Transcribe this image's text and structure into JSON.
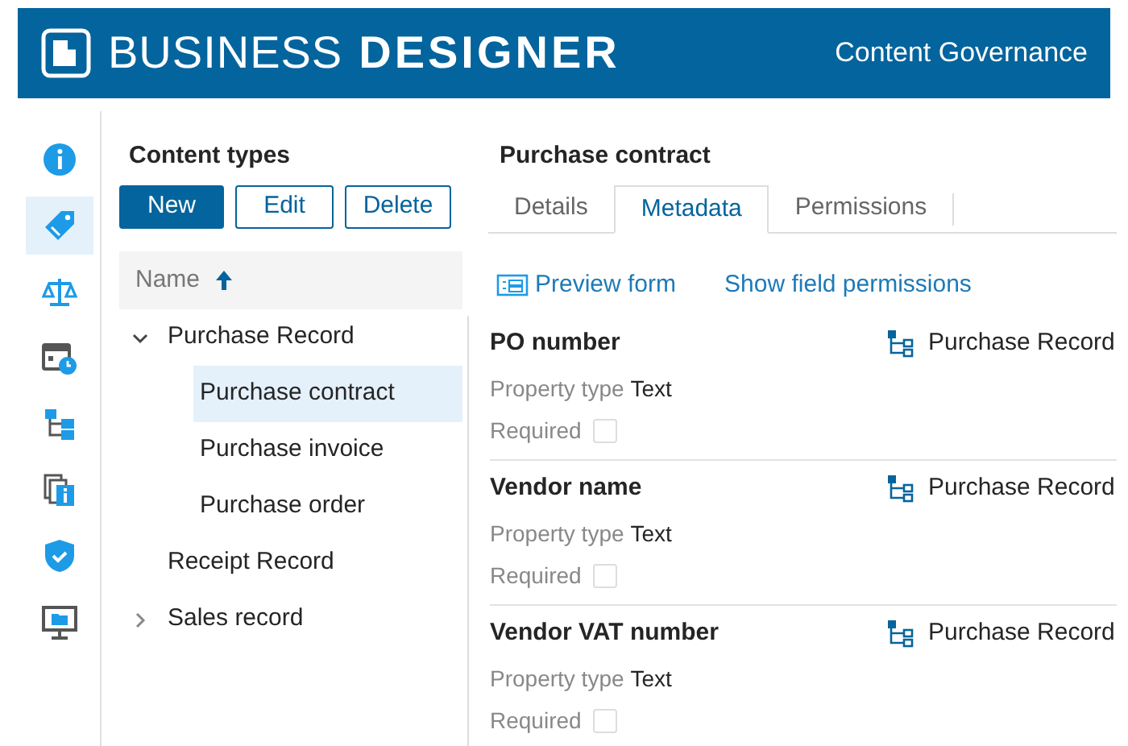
{
  "header": {
    "logo_light": "BUSINESS",
    "logo_bold": "DESIGNER",
    "title": "Content Governance"
  },
  "nav": [
    {
      "kind": "info",
      "selected": false
    },
    {
      "kind": "tag",
      "selected": true
    },
    {
      "kind": "scale",
      "selected": false
    },
    {
      "kind": "calendar",
      "selected": false
    },
    {
      "kind": "tree",
      "selected": false
    },
    {
      "kind": "docs",
      "selected": false
    },
    {
      "kind": "shield",
      "selected": false
    },
    {
      "kind": "monitor",
      "selected": false
    }
  ],
  "content_types": {
    "title": "Content types",
    "buttons": [
      {
        "label": "New",
        "primary": true
      },
      {
        "label": "Edit",
        "primary": false
      },
      {
        "label": "Delete",
        "primary": false
      }
    ],
    "column": {
      "label": "Name",
      "sorted_ascending": true
    },
    "tree": [
      {
        "label": "Purchase Record",
        "expanded": true,
        "selected": false,
        "children": [
          {
            "label": "Purchase contract",
            "selected": true
          },
          {
            "label": "Purchase invoice",
            "selected": false
          },
          {
            "label": "Purchase order",
            "selected": false
          }
        ]
      },
      {
        "label": "Receipt Record",
        "selected": false
      },
      {
        "label": "Sales record",
        "expanded": false,
        "selected": false
      }
    ]
  },
  "detail": {
    "title": "Purchase contract",
    "tabs": [
      {
        "label": "Details",
        "selected": false
      },
      {
        "label": "Metadata",
        "selected": true
      },
      {
        "label": "Permissions",
        "selected": false
      }
    ],
    "actions": [
      {
        "label": "Preview form",
        "kind": "icon"
      },
      {
        "label": "Show field permissions",
        "kind": "plain"
      }
    ],
    "fields": [
      {
        "name": "PO number",
        "source": "Purchase Record",
        "type_label": "Property type",
        "type": "Text",
        "required_label": "Required",
        "required": false
      },
      {
        "name": "Vendor name",
        "source": "Purchase Record",
        "type_label": "Property type",
        "type": "Text",
        "required_label": "Required",
        "required": false
      },
      {
        "name": "Vendor VAT number",
        "source": "Purchase Record",
        "type_label": "Property type",
        "type": "Text",
        "required_label": "Required",
        "required": false
      }
    ]
  }
}
